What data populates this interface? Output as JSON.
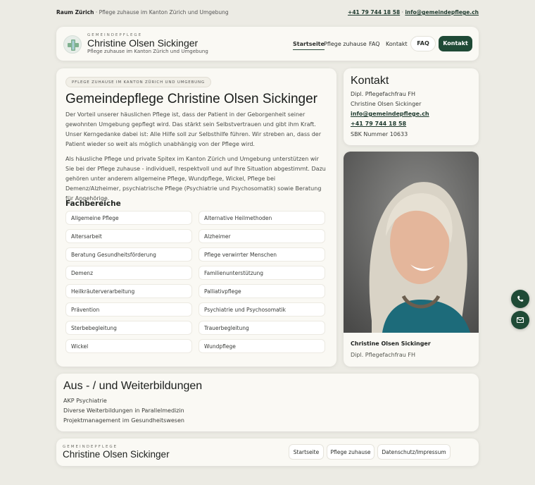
{
  "topbar": {
    "region": "Raum Zürich",
    "separator": "·",
    "tagline": "Pflege zuhause im Kanton Zürich und Umgebung",
    "phone": "+41 79 744 18 58",
    "dot": "·",
    "email": "info@gemeindepflege.ch"
  },
  "header": {
    "kicker": "GEMEINDEPFLEGE",
    "name": "Christine Olsen Sickinger",
    "subtitle": "Pflege zuhause im Kanton Zürich und Umgebung",
    "nav": [
      "Startseite",
      "Pflege zuhause",
      "FAQ",
      "Kontakt"
    ],
    "faq_button": "FAQ",
    "kontakt_button": "Kontakt"
  },
  "main": {
    "badge": "PFLEGE ZUHAUSE IM KANTON ZÜRICH UND UMGEBUNG",
    "title": "Gemeindepflege Christine Olsen Sickinger",
    "paragraph1": "Der Vorteil unserer häuslichen Pflege ist, dass der Patient in der Geborgenheit seiner gewohnten Umgebung gepflegt wird. Das stärkt sein Selbstvertrauen und gibt ihm Kraft. Unser Kerngedanke dabei ist: Alle Hilfe soll zur Selbsthilfe führen. Wir streben an, dass der Patient wieder so weit als möglich unabhängig von der Pflege wird.",
    "paragraph2": "Als häusliche Pflege und private Spitex im Kanton Zürich und Umgebung unterstützen wir Sie bei der Pflege zuhause - individuell, respektvoll und auf Ihre Situation abgestimmt. Dazu gehören unter anderem allgemeine Pflege, Wundpflege, Wickel, Pflege bei Demenz/Alzheimer, psychiatrische Pflege (Psychiatrie und Psychosomatik) sowie Beratung für Angehörige.",
    "fach_title": "Fachbereiche",
    "fach_left": [
      "Allgemeine Pflege",
      "Altersarbeit",
      "Beratung Gesundheitsförderung",
      "Demenz",
      "Heilkräuterverarbeitung",
      "Prävention",
      "Sterbebegleitung",
      "Wickel"
    ],
    "fach_right": [
      "Alternative Heilmethoden",
      "Alzheimer",
      "Pflege verwirrter Menschen",
      "Familienunterstützung",
      "Palliativpflege",
      "Psychiatrie und Psychosomatik",
      "Trauerbegleitung",
      "Wundpflege"
    ]
  },
  "kontakt": {
    "title": "Kontakt",
    "role": "Dipl. Pflegefachfrau FH",
    "name": "Christine Olsen Sickinger",
    "email": "info@gemeindepflege.ch",
    "phone": "+41 79 744 18 58",
    "sbk": "SBK Nummer 10633"
  },
  "portrait": {
    "name": "Christine Olsen Sickinger",
    "role": "Dipl. Pflegefachfrau FH"
  },
  "fab": {
    "phone_icon": "phone-icon",
    "mail_icon": "mail-icon"
  },
  "education": {
    "title": "Aus - / und Weiterbildungen",
    "items": [
      "AKP Psychiatrie",
      "Diverse Weiterbildungen in Parallelmedizin",
      "Projektmanagement im Gesundheitswesen"
    ]
  },
  "footer": {
    "kicker": "GEMEINDEPFLEGE",
    "name": "Christine Olsen Sickinger",
    "links": [
      "Startseite",
      "Pflege zuhause",
      "Datenschutz/Impressum"
    ]
  },
  "colors": {
    "accent": "#1f4a36",
    "background": "#ecebe4",
    "card": "#faf9f4"
  }
}
